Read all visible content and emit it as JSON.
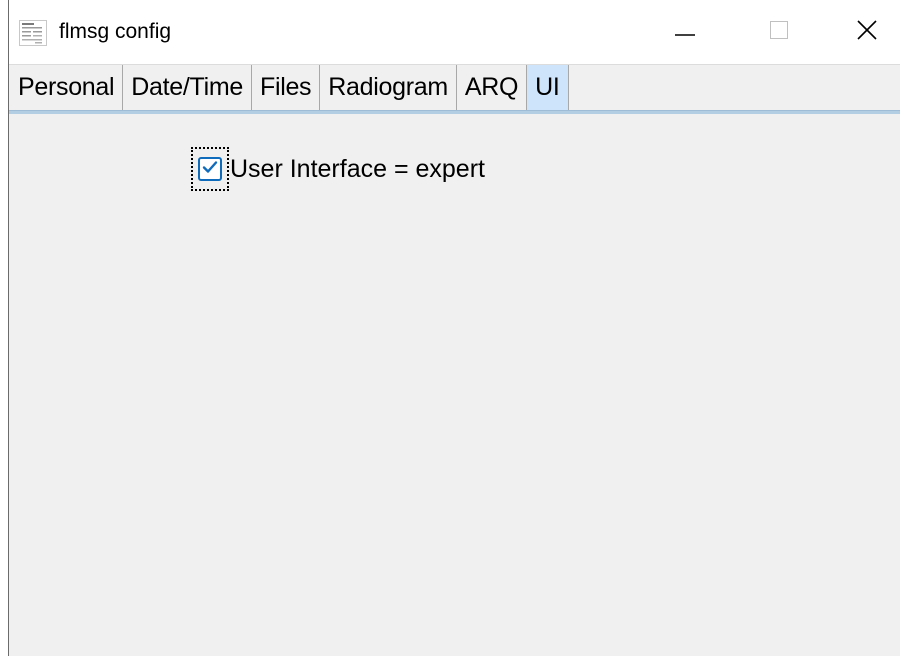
{
  "window": {
    "title": "flmsg config",
    "controls": {
      "minimize": "minimize-icon",
      "maximize": "maximize-icon",
      "close": "close-icon"
    }
  },
  "tabs": [
    {
      "label": "Personal",
      "active": false
    },
    {
      "label": "Date/Time",
      "active": false
    },
    {
      "label": "Files",
      "active": false
    },
    {
      "label": "Radiogram",
      "active": false
    },
    {
      "label": "ARQ",
      "active": false
    },
    {
      "label": "UI",
      "active": true
    }
  ],
  "ui_panel": {
    "expert_checkbox": {
      "label": "User Interface = expert",
      "checked": true
    }
  },
  "colors": {
    "accent": "#0f6cbd",
    "active_tab": "#cde4fb",
    "tab_rule": "#b3cde3",
    "background": "#f0f0f0"
  }
}
